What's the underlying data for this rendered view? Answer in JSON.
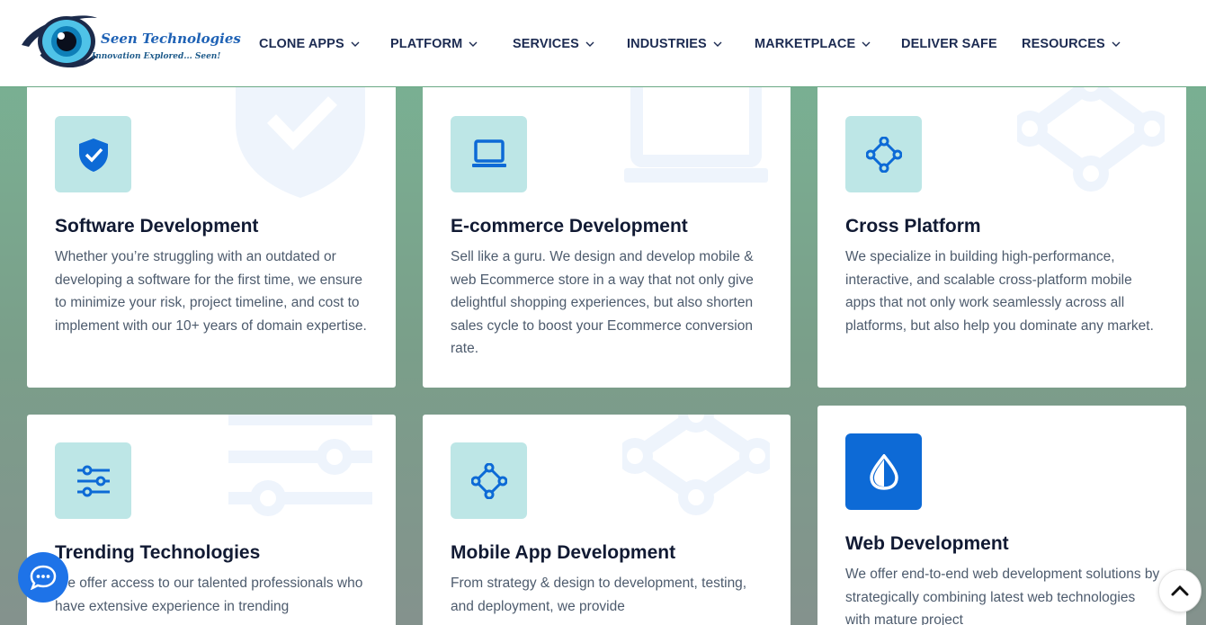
{
  "brand": {
    "name": "Seen Technologies",
    "tagline": "Innovation Explored... Seen!"
  },
  "nav": [
    {
      "label": "CLONE APPS",
      "has_dropdown": true
    },
    {
      "label": "PLATFORM",
      "has_dropdown": true
    },
    {
      "label": "SERVICES",
      "has_dropdown": true
    },
    {
      "label": "INDUSTRIES",
      "has_dropdown": true
    },
    {
      "label": "MARKETPLACE",
      "has_dropdown": true
    },
    {
      "label": "DELIVER SAFE",
      "has_dropdown": false
    },
    {
      "label": "RESOURCES",
      "has_dropdown": true
    }
  ],
  "cards": [
    {
      "title": "Software Development",
      "icon": "shield-check-icon",
      "description": "Whether you’re struggling with an outdated or developing a software for the first time, we ensure to minimize your risk, project timeline, and cost to implement with our 10+ years of domain expertise."
    },
    {
      "title": "E-commerce Development",
      "icon": "laptop-icon",
      "description": "Sell like a guru. We design and develop mobile & web Ecommerce store in a way that not only give delightful shopping experiences, but also shorten sales cycle to boost your Ecommerce conversion rate."
    },
    {
      "title": "Cross Platform",
      "icon": "nodes-icon",
      "description": "We specialize in building high-performance, interactive, and scalable cross-platform mobile apps that not only work seamlessly across all platforms, but also help you dominate any market."
    },
    {
      "title": "Trending Technologies",
      "icon": "sliders-icon",
      "description": "We offer access to our talented professionals who have extensive experience in trending"
    },
    {
      "title": "Mobile App Development",
      "icon": "nodes-icon",
      "description": "From strategy & design to development, testing, and deployment, we provide"
    },
    {
      "title": "Web Development",
      "icon": "drop-icon",
      "description": "We offer end-to-end web development solutions by strategically combining latest web technologies with mature project"
    }
  ],
  "colors": {
    "accent": "#0d6ad6",
    "icon_bg": "#bde6e6",
    "nav_text": "#1c2b52",
    "chat_button": "#1e73e8"
  }
}
